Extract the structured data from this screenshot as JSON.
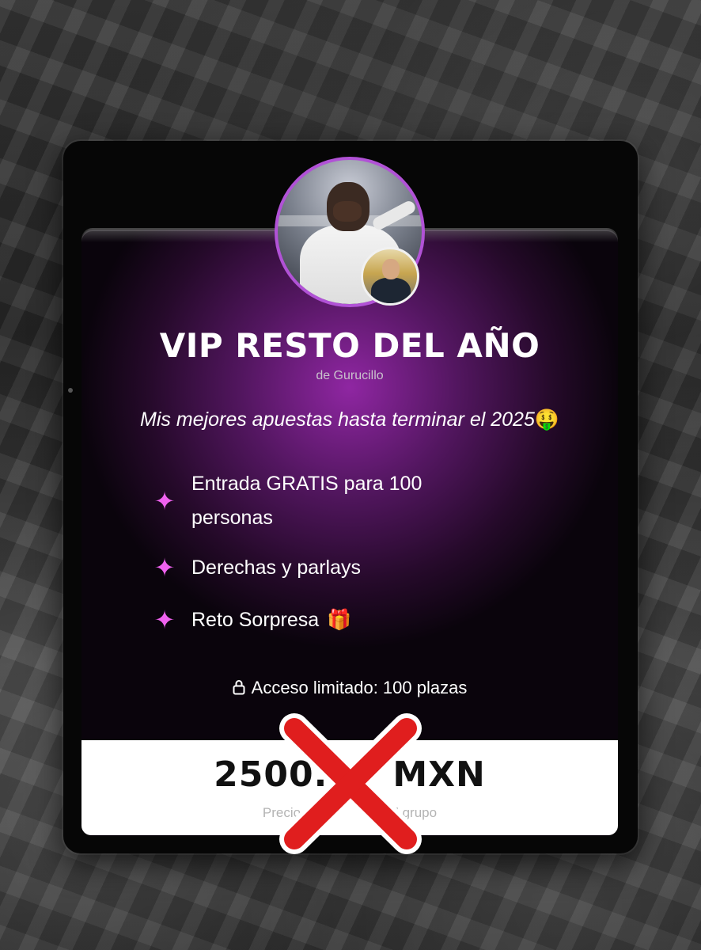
{
  "offer": {
    "title": "VIP RESTO DEL AÑO",
    "byline": "de Gurucillo",
    "tagline": "Mis mejores apuestas hasta terminar el 2025",
    "tagline_emoji": "🤑"
  },
  "features": [
    {
      "icon": "sparkle-icon",
      "text_line1": "Entrada GRATIS para 100",
      "text_line2": "personas"
    },
    {
      "icon": "sparkle-icon",
      "text": "Derechas y parlays"
    },
    {
      "icon": "sparkle-icon",
      "text": "Reto Sorpresa",
      "emoji": "🎁"
    }
  ],
  "access": {
    "icon": "lock-icon",
    "text": "Acceso limitado: 100 plazas"
  },
  "price": {
    "amount_visible_left": "2500.",
    "amount_visible_right": "MXN",
    "subtitle_left": "Precio",
    "subtitle_right": "l grupo"
  },
  "colors": {
    "accent": "#b152d6",
    "sparkle": "#f062ef",
    "cross": "#e01e1e"
  }
}
